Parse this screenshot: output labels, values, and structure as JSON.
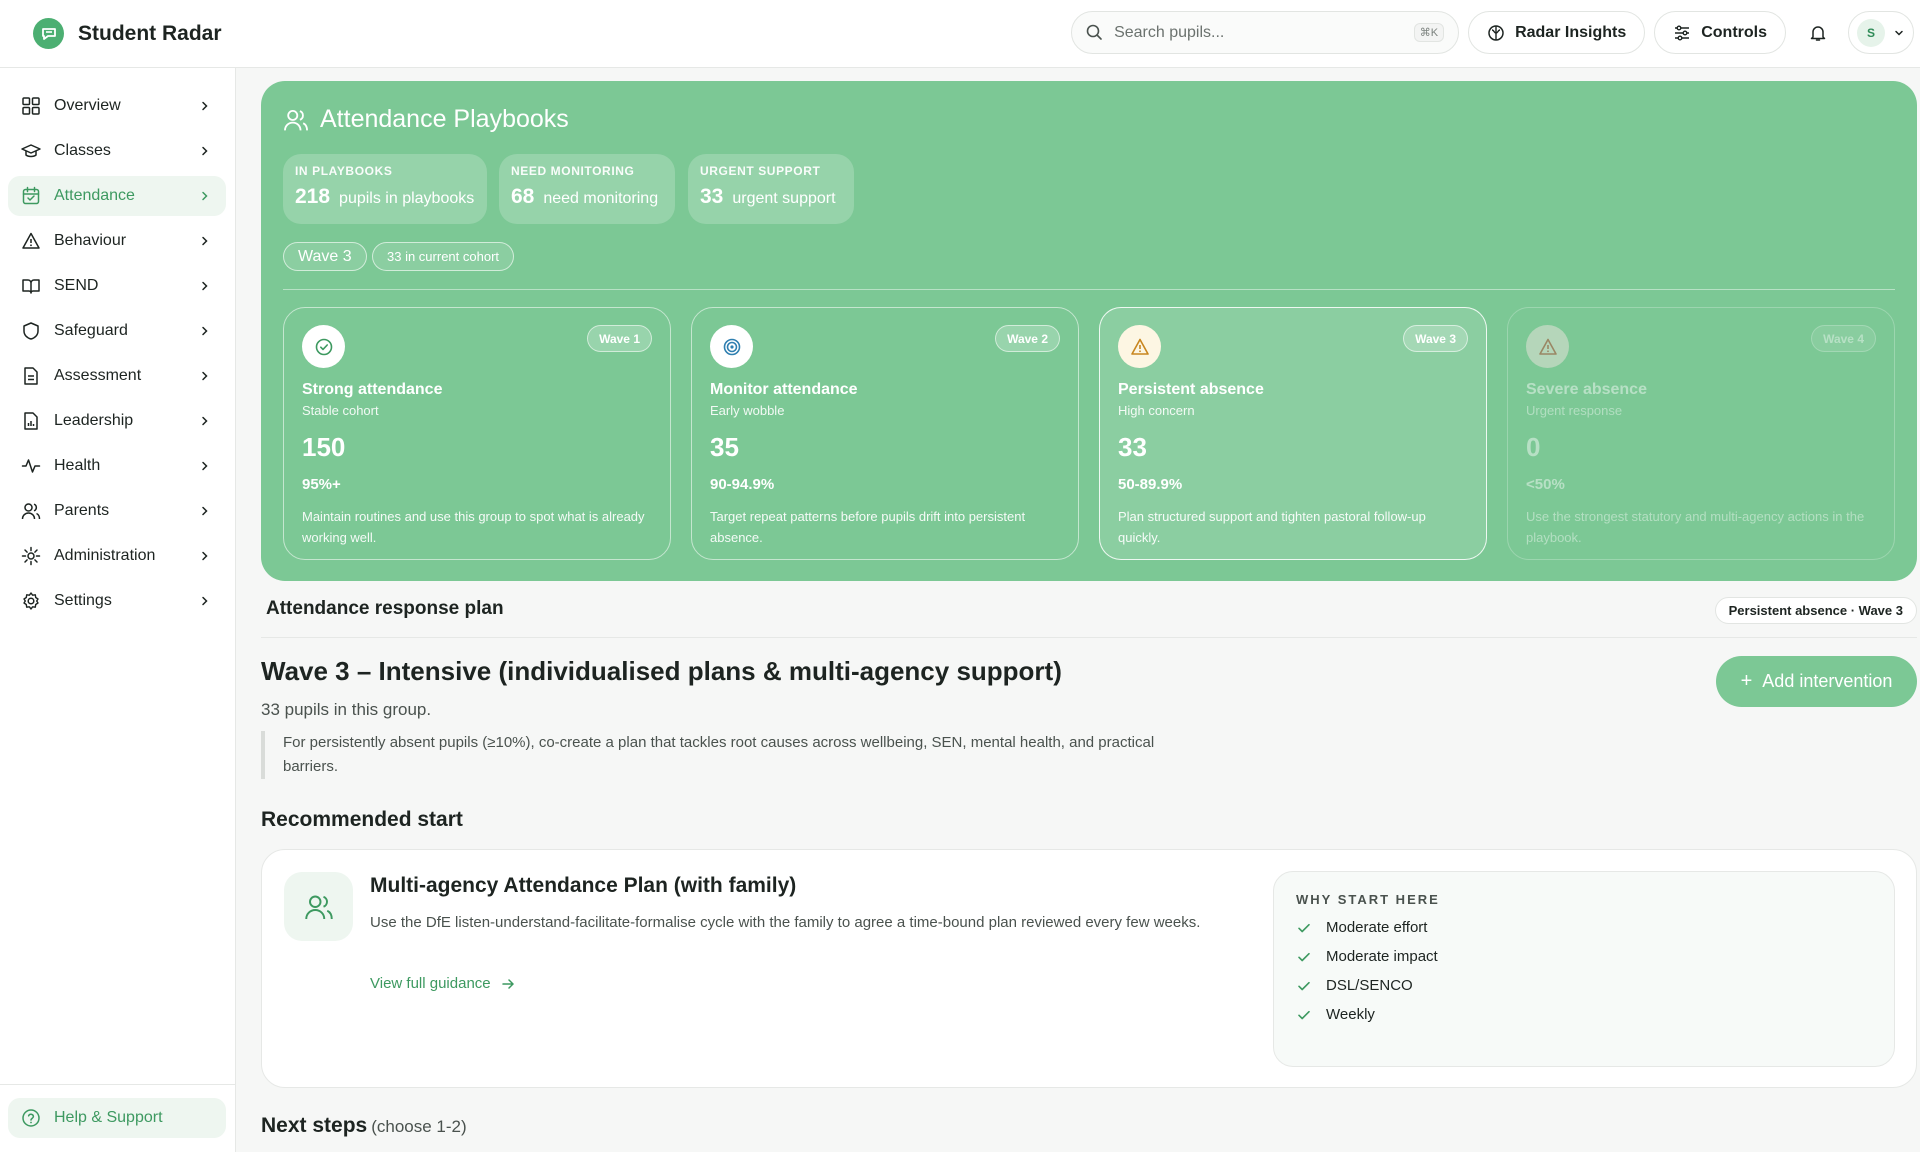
{
  "app": {
    "title": "Student Radar"
  },
  "header": {
    "search_placeholder": "Search pupils...",
    "search_shortcut": "⌘K",
    "insights_label": "Radar Insights",
    "controls_label": "Controls",
    "user_initial": "S"
  },
  "sidebar": {
    "items": [
      {
        "label": "Overview",
        "icon": "grid-icon"
      },
      {
        "label": "Classes",
        "icon": "graduation-cap-icon"
      },
      {
        "label": "Attendance",
        "icon": "calendar-icon",
        "active": true
      },
      {
        "label": "Behaviour",
        "icon": "warning-icon"
      },
      {
        "label": "SEND",
        "icon": "book-icon"
      },
      {
        "label": "Safeguard",
        "icon": "shield-icon"
      },
      {
        "label": "Assessment",
        "icon": "document-icon"
      },
      {
        "label": "Leadership",
        "icon": "report-icon"
      },
      {
        "label": "Health",
        "icon": "activity-icon"
      },
      {
        "label": "Parents",
        "icon": "users-icon"
      },
      {
        "label": "Administration",
        "icon": "gear-icon"
      },
      {
        "label": "Settings",
        "icon": "settings-icon"
      }
    ],
    "help_label": "Help & Support"
  },
  "hero": {
    "title": "Attendance Playbooks",
    "stats": [
      {
        "caption": "IN PLAYBOOKS",
        "value": "218",
        "text": "pupils in playbooks"
      },
      {
        "caption": "NEED MONITORING",
        "value": "68",
        "text": "need monitoring"
      },
      {
        "caption": "URGENT SUPPORT",
        "value": "33",
        "text": "urgent support"
      }
    ],
    "tags": {
      "wave": "Wave 3",
      "cohort": "33 in current cohort"
    },
    "waves": [
      {
        "badge": "Wave 1",
        "name": "Strong attendance",
        "sub": "Stable cohort",
        "count": "150",
        "range": "95%+",
        "desc": "Maintain routines and use this group to spot what is already working well.",
        "icon": "check-circle-icon"
      },
      {
        "badge": "Wave 2",
        "name": "Monitor attendance",
        "sub": "Early wobble",
        "count": "35",
        "range": "90-94.9%",
        "desc": "Target repeat patterns before pupils drift into persistent absence.",
        "icon": "target-icon"
      },
      {
        "badge": "Wave 3",
        "name": "Persistent absence",
        "sub": "High concern",
        "count": "33",
        "range": "50-89.9%",
        "desc": "Plan structured support and tighten pastoral follow-up quickly.",
        "icon": "alert-triangle-icon"
      },
      {
        "badge": "Wave 4",
        "name": "Severe absence",
        "sub": "Urgent response",
        "count": "0",
        "range": "<50%",
        "desc": "Use the strongest statutory and multi-agency actions in the playbook.",
        "icon": "alert-triangle-red-icon"
      }
    ]
  },
  "plan": {
    "heading": "Attendance response plan",
    "badge": "Persistent absence · Wave 3",
    "title": "Wave 3 – Intensive (individualised plans & multi-agency support)",
    "add_label": "Add intervention",
    "pupils_line": "33 pupils in this group.",
    "quote": "For persistently absent pupils (≥10%), co-create a plan that tackles root causes across wellbeing, SEN, mental health, and practical barriers."
  },
  "recommended": {
    "heading": "Recommended start",
    "title": "Multi-agency Attendance Plan (with family)",
    "desc": "Use the DfE listen-understand-facilitate-formalise cycle with the family to agree a time-bound plan reviewed every few weeks.",
    "link": "View full guidance",
    "why_caption": "WHY START HERE",
    "why_items": [
      "Moderate effort",
      "Moderate impact",
      "DSL/SENCO",
      "Weekly"
    ]
  },
  "next": {
    "heading": "Next steps",
    "hint": "(choose 1-2)"
  },
  "colors": {
    "accent": "#7cc895",
    "accent_dark": "#3d9960",
    "warning": "#c8861f",
    "danger": "#c0392b"
  }
}
